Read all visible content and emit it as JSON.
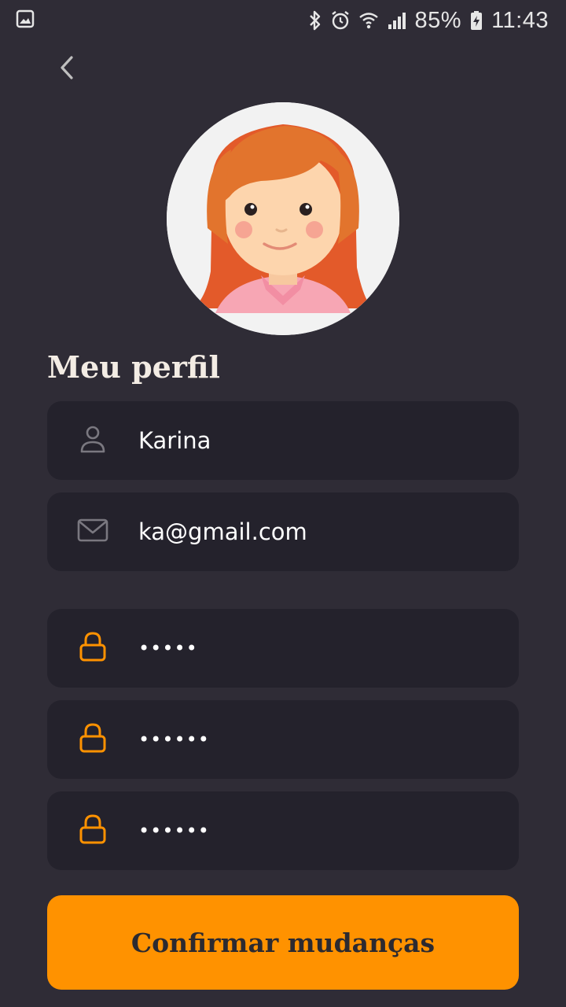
{
  "status_bar": {
    "battery": "85%",
    "time": "11:43",
    "icons": [
      "gallery-icon",
      "bluetooth-icon",
      "alarm-icon",
      "wifi-icon",
      "signal-icon",
      "battery-charging-icon"
    ]
  },
  "header": {
    "back_icon": "chevron-left-icon"
  },
  "profile": {
    "title": "Meu perfil",
    "name": "Karina",
    "email": "ka@gmail.com",
    "password_current": "•••••",
    "password_new": "••••••",
    "password_confirm": "••••••"
  },
  "actions": {
    "confirm_label": "Confirmar mudanças"
  },
  "colors": {
    "background": "#2f2c36",
    "field": "#24222c",
    "accent": "#ff9200",
    "title": "#f3ece4"
  }
}
